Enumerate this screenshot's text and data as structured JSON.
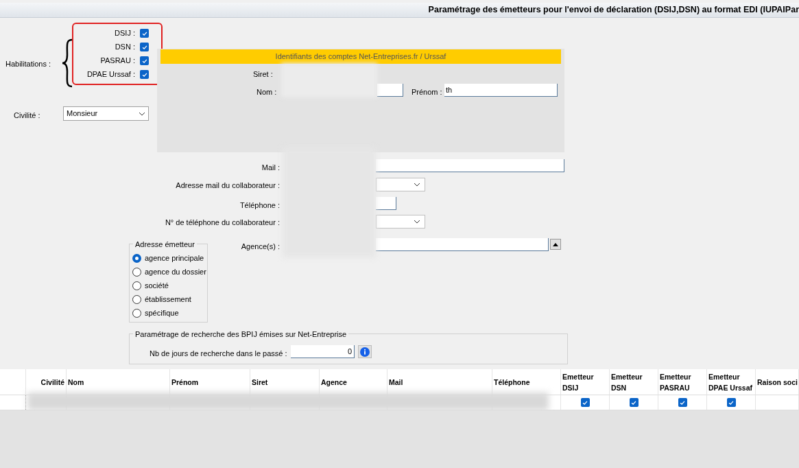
{
  "window": {
    "title": "Paramétrage des émetteurs pour l'envoi de déclaration (DSIJ,DSN) au format EDI (IUPAIPar"
  },
  "habilitations": {
    "label": "Habilitations :",
    "items": [
      {
        "label": "DSIJ :",
        "checked": true
      },
      {
        "label": "DSN :",
        "checked": true
      },
      {
        "label": "PASRAU :",
        "checked": true
      },
      {
        "label": "DPAE Urssaf :",
        "checked": true
      }
    ]
  },
  "civilite": {
    "label": "Civilité :",
    "value": "Monsieur"
  },
  "net_entreprises": {
    "header": "Identifiants des comptes Net-Entreprises.fr / Urssaf",
    "siret_label": "Siret :",
    "nom_label": "Nom :",
    "prenom_label": "Prénom :",
    "prenom_value": "th"
  },
  "contact": {
    "mail_label": "Mail :",
    "collab_mail_label": "Adresse mail du collaborateur :",
    "phone_label": "Téléphone :",
    "collab_phone_label": "N° de téléphone du collaborateur :",
    "agences_label": "Agence(s) :"
  },
  "adresse_emetteur": {
    "legend": "Adresse émetteur",
    "options": [
      {
        "label": "agence principale",
        "selected": true
      },
      {
        "label": "agence du dossier",
        "selected": false
      },
      {
        "label": "société",
        "selected": false
      },
      {
        "label": "établissement",
        "selected": false
      },
      {
        "label": "spécifique",
        "selected": false
      }
    ]
  },
  "recherche": {
    "legend": "Paramétrage de recherche des BPIJ émises sur Net-Entreprise",
    "label": "Nb de jours de recherche dans le passé :",
    "value": "0"
  },
  "table": {
    "columns": [
      "Civilité",
      "Nom",
      "Prénom",
      "Siret",
      "Agence",
      "Mail",
      "Téléphone",
      "Emetteur DSIJ",
      "Emetteur DSN",
      "Emetteur PASRAU",
      "Emetteur DPAE Urssaf",
      "Raison soci"
    ],
    "rows": [
      {
        "checks": [
          true,
          true,
          true,
          true
        ]
      }
    ]
  }
}
